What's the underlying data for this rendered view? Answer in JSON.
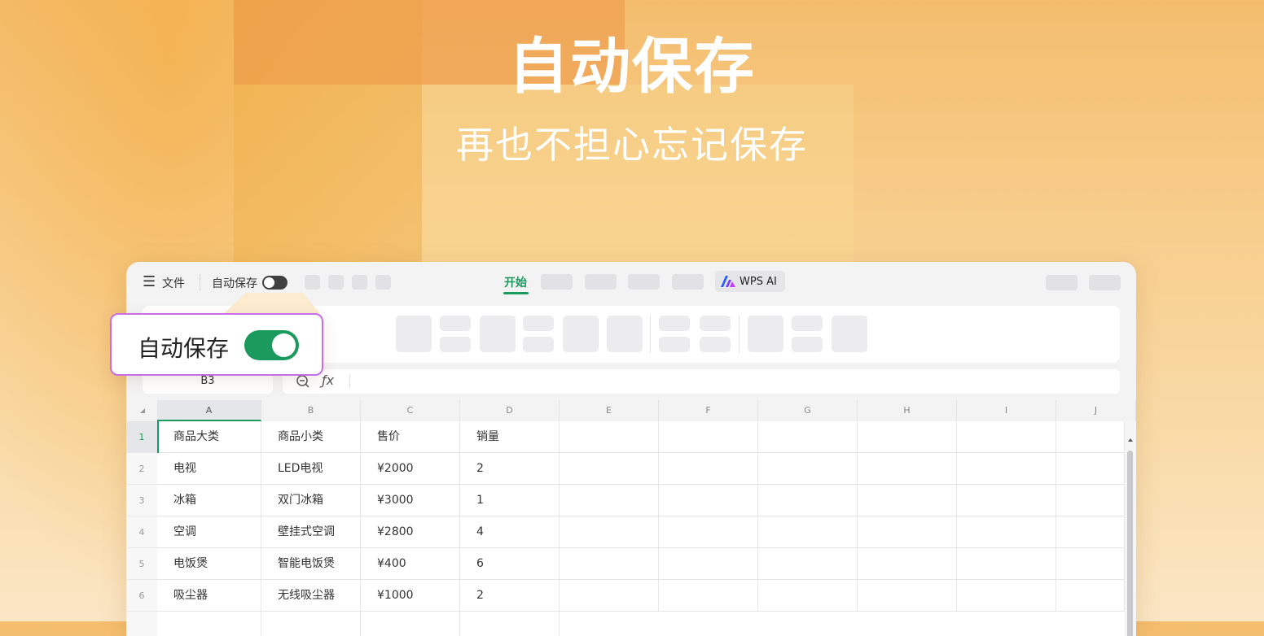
{
  "hero": {
    "title": "自动保存",
    "subtitle": "再也不担心忘记保存"
  },
  "toolbar": {
    "menu_icon": "hamburger-icon",
    "file_label": "文件",
    "autosave_label": "自动保存",
    "autosave_enabled": false,
    "active_tab": "开始",
    "wps_ai_label": "WPS AI",
    "accent_color": "#1a9a5c"
  },
  "formula_bar": {
    "cell_ref": "B3",
    "fx_label": "ƒx",
    "value": ""
  },
  "grid": {
    "columns": [
      "A",
      "B",
      "C",
      "D",
      "E",
      "F",
      "G",
      "H",
      "I",
      "J"
    ],
    "rows": [
      {
        "num": "1",
        "cells": [
          "商品大类",
          "商品小类",
          "售价",
          "销量"
        ]
      },
      {
        "num": "2",
        "cells": [
          "电视",
          "LED电视",
          "¥2000",
          "2"
        ]
      },
      {
        "num": "3",
        "cells": [
          "冰箱",
          "双门冰箱",
          "¥3000",
          "1"
        ]
      },
      {
        "num": "4",
        "cells": [
          "空调",
          "壁挂式空调",
          "¥2800",
          "4"
        ]
      },
      {
        "num": "5",
        "cells": [
          "电饭煲",
          "智能电饭煲",
          "¥400",
          "6"
        ]
      },
      {
        "num": "6",
        "cells": [
          "吸尘器",
          "无线吸尘器",
          "¥1000",
          "2"
        ]
      }
    ]
  },
  "callout": {
    "label": "自动保存",
    "toggle_on": true,
    "border_color": "#c66ee6"
  }
}
